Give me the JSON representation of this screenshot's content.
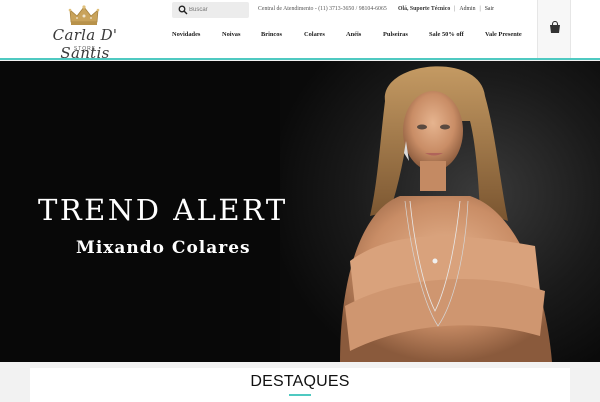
{
  "brand": {
    "name": "Carla D' Santis",
    "subtitle": "STORE",
    "crown_color": "#c9a35b"
  },
  "search": {
    "placeholder": "Buscar",
    "icon": "search-icon"
  },
  "header": {
    "contact": "Central de Atendimento - (11) 3713-3650 / 98104-6065",
    "account": {
      "greeting": "Olá, Suporte Técnico",
      "admin": "Admin",
      "logout": "Sair"
    },
    "accent_color": "#4fc9c1"
  },
  "nav": {
    "items": [
      {
        "label": "Novidades"
      },
      {
        "label": "Noivas"
      },
      {
        "label": "Brincos"
      },
      {
        "label": "Colares"
      },
      {
        "label": "Anéis"
      },
      {
        "label": "Pulseiras"
      },
      {
        "label": "Sale 50% off"
      },
      {
        "label": "Vale Presente"
      }
    ]
  },
  "cart": {
    "icon": "shopping-bag-icon"
  },
  "hero": {
    "headline": "TREND ALERT",
    "subline": "Mixando Colares"
  },
  "section": {
    "title": "DESTAQUES"
  }
}
